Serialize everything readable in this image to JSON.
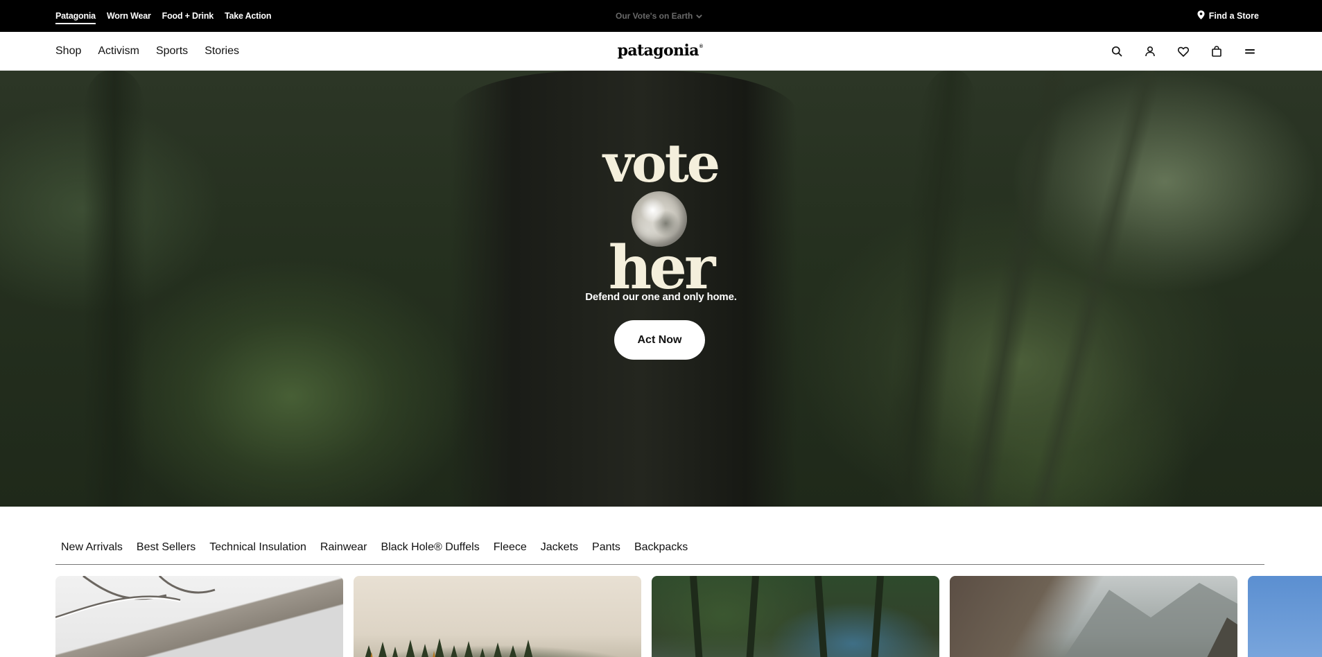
{
  "utility_bar": {
    "links": [
      "Patagonia",
      "Worn Wear",
      "Food + Drink",
      "Take Action"
    ],
    "announcement": "Our Vote's on Earth",
    "find_store": "Find a Store"
  },
  "main_nav": {
    "links": [
      "Shop",
      "Activism",
      "Sports",
      "Stories"
    ],
    "logo": "patagonia",
    "logo_mark": "®",
    "icons": [
      "search-icon",
      "account-icon",
      "wishlist-icon",
      "cart-icon",
      "menu-icon"
    ]
  },
  "hero": {
    "headline_top": "vote",
    "headline_bottom": "her",
    "subtitle": "Defend our one and only home.",
    "cta": "Act Now"
  },
  "categories": [
    "New Arrivals",
    "Best Sellers",
    "Technical Insulation",
    "Rainwear",
    "Black Hole® Duffels",
    "Fleece",
    "Jackets",
    "Pants",
    "Backpacks"
  ],
  "colors": {
    "utility_bg": "#000000",
    "headline_cream": "#f4efdc",
    "cta_bg": "#ffffff"
  }
}
